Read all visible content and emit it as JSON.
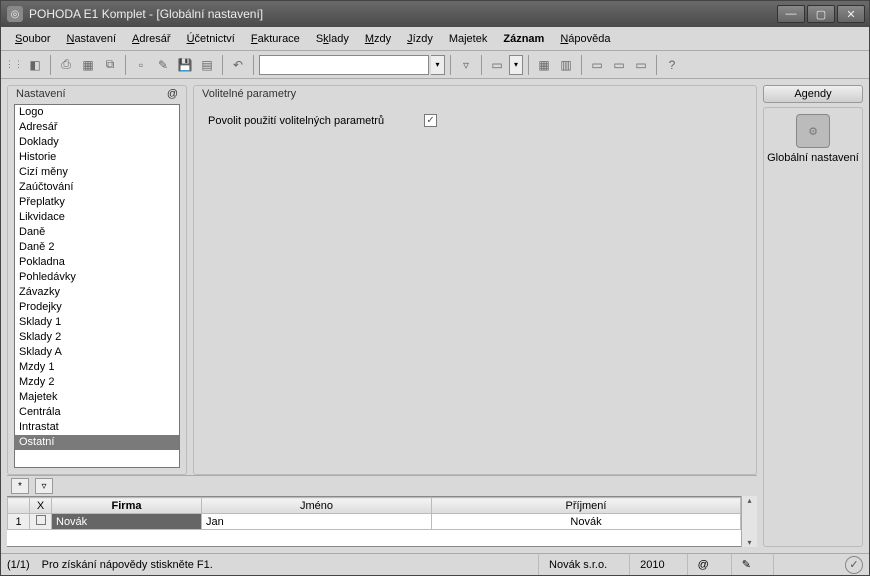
{
  "window": {
    "title": "POHODA E1 Komplet - [Globální nastavení]"
  },
  "menu": {
    "items": [
      {
        "pre": "",
        "ul": "S",
        "post": "oubor"
      },
      {
        "pre": "",
        "ul": "N",
        "post": "astavení"
      },
      {
        "pre": "",
        "ul": "A",
        "post": "dresář"
      },
      {
        "pre": "",
        "ul": "Ú",
        "post": "četnictví"
      },
      {
        "pre": "",
        "ul": "F",
        "post": "akturace"
      },
      {
        "pre": "S",
        "ul": "k",
        "post": "lady"
      },
      {
        "pre": "",
        "ul": "M",
        "post": "zdy"
      },
      {
        "pre": "",
        "ul": "J",
        "post": "ízdy"
      },
      {
        "pre": "",
        "ul": "",
        "post": "Majetek"
      },
      {
        "pre": "",
        "ul": "",
        "post": "Záznam",
        "strong": true
      },
      {
        "pre": "",
        "ul": "N",
        "post": "ápověda"
      }
    ]
  },
  "toolbar": {
    "combo_value": ""
  },
  "sidebar": {
    "header": "Nastavení",
    "badge": "@",
    "items": [
      "Logo",
      "Adresář",
      "Doklady",
      "Historie",
      "Cizí měny",
      "Zaúčtování",
      "Přeplatky",
      "Likvidace",
      "Daně",
      "Daně 2",
      "Pokladna",
      "Pohledávky",
      "Závazky",
      "Prodejky",
      "Sklady 1",
      "Sklady 2",
      "Sklady A",
      "Mzdy 1",
      "Mzdy 2",
      "Majetek",
      "Centrála",
      "Intrastat",
      "Ostatní"
    ],
    "selected_index": 22
  },
  "center": {
    "header": "Volitelné parametry",
    "checkbox_label": "Povolit použití volitelných parametrů",
    "checkbox_checked": true
  },
  "agendy": {
    "header": "Agendy",
    "item_label": "Globální nastavení"
  },
  "grid": {
    "columns": {
      "chk": "X",
      "firma": "Firma",
      "jmeno": "Jméno",
      "prijmeni": "Příjmení"
    },
    "rows": [
      {
        "num": "1",
        "firma": "Novák",
        "jmeno": "Jan",
        "prijmeni": "Novák"
      }
    ]
  },
  "status": {
    "pos": "(1/1)",
    "hint": "Pro získání nápovědy stiskněte F1.",
    "company": "Novák  s.r.o.",
    "year": "2010",
    "at": "@"
  }
}
